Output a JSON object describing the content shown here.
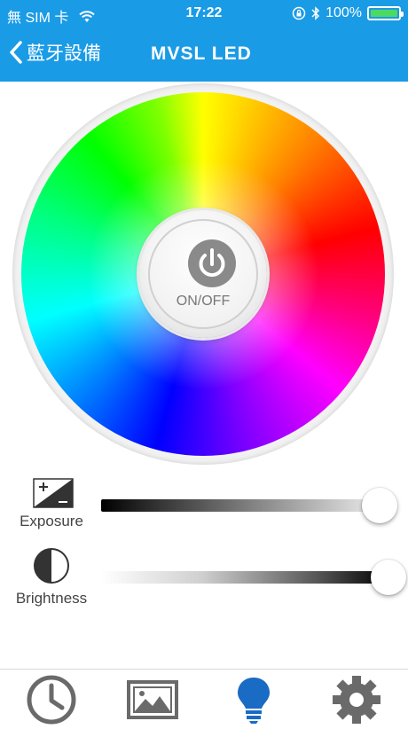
{
  "status_bar": {
    "carrier": "無 SIM 卡",
    "time": "17:22",
    "battery": "100%"
  },
  "nav": {
    "back_label": "藍牙設備",
    "title": "MVSL LED"
  },
  "color_wheel": {
    "power_label": "ON/OFF"
  },
  "sliders": [
    {
      "label": "Exposure",
      "value": 1.0
    },
    {
      "label": "Brightness",
      "value": 1.0
    }
  ],
  "tabs": [
    {
      "icon": "clock-icon",
      "active": false
    },
    {
      "icon": "image-icon",
      "active": false
    },
    {
      "icon": "bulb-icon",
      "active": true
    },
    {
      "icon": "gear-icon",
      "active": false
    }
  ],
  "colors": {
    "header": "#1a9be6",
    "tab_active": "#1a6bc4",
    "tab_inactive": "#6a6a6a"
  }
}
